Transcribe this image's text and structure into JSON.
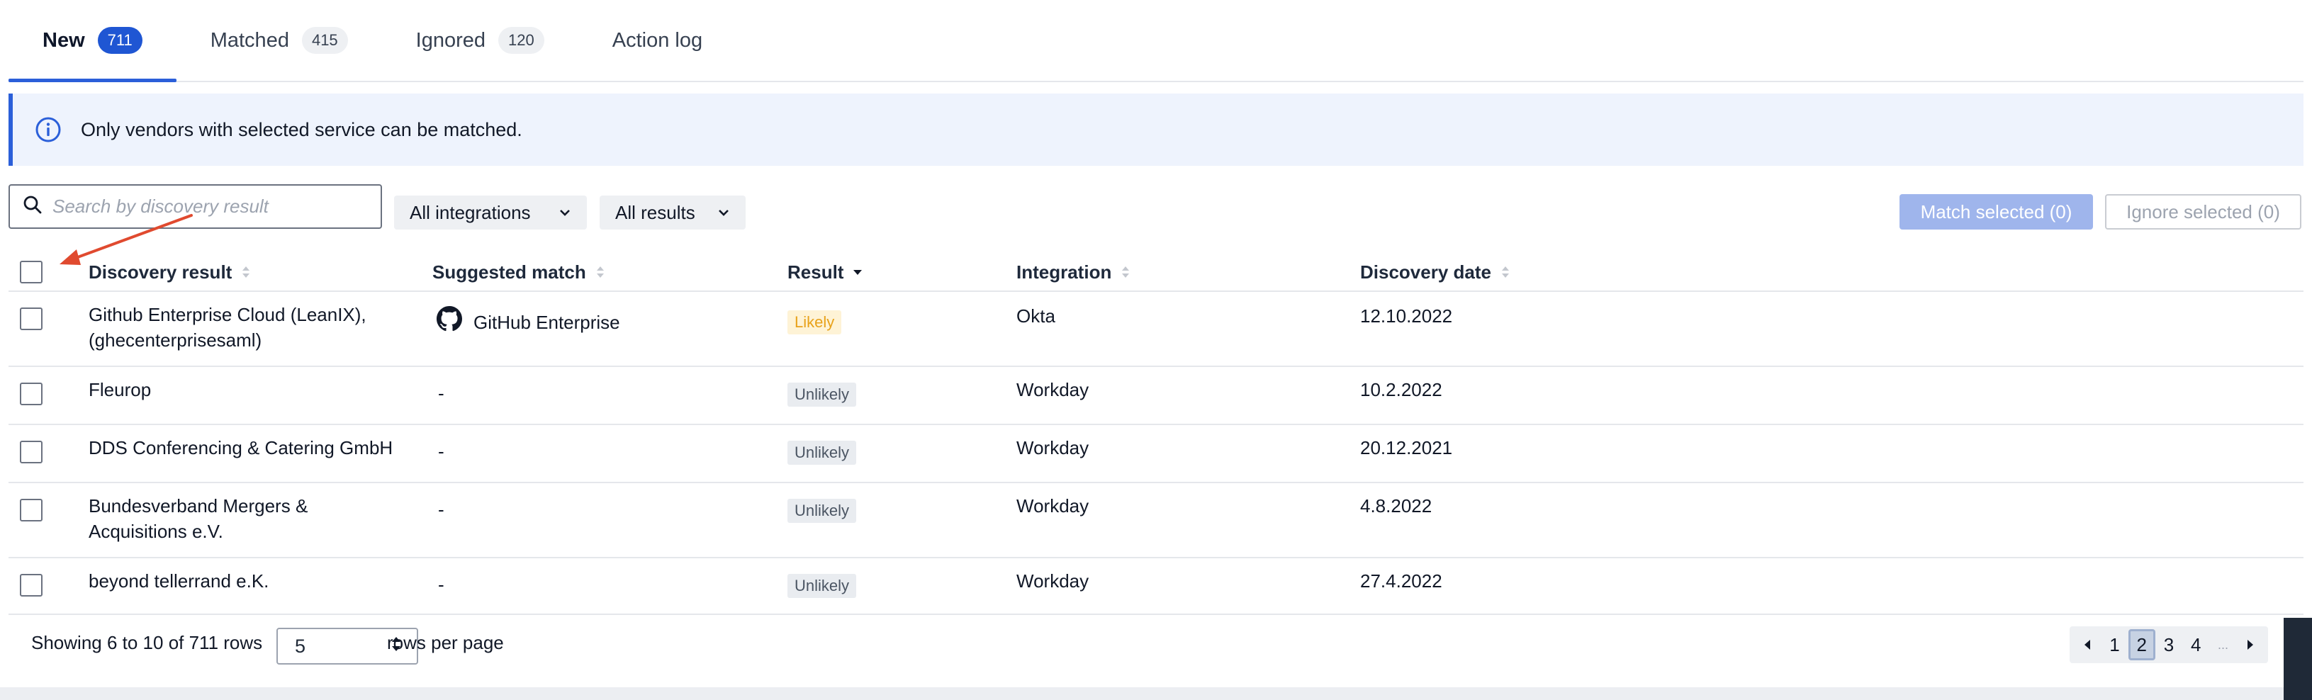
{
  "tabs": [
    {
      "label": "New",
      "count": "711",
      "active": true
    },
    {
      "label": "Matched",
      "count": "415",
      "active": false
    },
    {
      "label": "Ignored",
      "count": "120",
      "active": false
    },
    {
      "label": "Action log",
      "count": null,
      "active": false
    }
  ],
  "banner": {
    "icon": "info-icon",
    "text": "Only vendors with selected service can be matched."
  },
  "filters": {
    "search_placeholder": "Search by discovery result",
    "search_value": "",
    "integration_select": "All integrations",
    "results_select": "All results",
    "match_selected": "Match selected (0)",
    "ignore_selected": "Ignore selected (0)"
  },
  "table": {
    "columns": [
      {
        "label": "Discovery result",
        "sort": "none"
      },
      {
        "label": "Suggested match",
        "sort": "none"
      },
      {
        "label": "Result",
        "sort": "descending"
      },
      {
        "label": "Integration",
        "sort": "none"
      },
      {
        "label": "Discovery date",
        "sort": "none"
      }
    ],
    "rows": [
      {
        "discovery": [
          "Github Enterprise Cloud (LeanIX),",
          "(ghecenterprisesaml)"
        ],
        "match": "GitHub Enterprise",
        "match_icon": "github-icon",
        "result": "Likely",
        "integration": "Okta",
        "date": "12.10.2022"
      },
      {
        "discovery": [
          "Fleurop"
        ],
        "match": "-",
        "match_icon": null,
        "result": "Unlikely",
        "integration": "Workday",
        "date": "10.2.2022"
      },
      {
        "discovery": [
          "DDS Conferencing & Catering GmbH"
        ],
        "match": "-",
        "match_icon": null,
        "result": "Unlikely",
        "integration": "Workday",
        "date": "20.12.2021"
      },
      {
        "discovery": [
          "Bundesverband Mergers &",
          "Acquisitions e.V."
        ],
        "match": "-",
        "match_icon": null,
        "result": "Unlikely",
        "integration": "Workday",
        "date": "4.8.2022"
      },
      {
        "discovery": [
          "beyond tellerrand e.K."
        ],
        "match": "-",
        "match_icon": null,
        "result": "Unlikely",
        "integration": "Workday",
        "date": "27.4.2022"
      }
    ]
  },
  "footer": {
    "showing": "Showing 6 to 10 of 711 rows",
    "rows_per_page_value": "5",
    "rows_per_page_label": "rows per page",
    "pages": [
      "1",
      "2",
      "3",
      "4"
    ],
    "current_page": "2",
    "ellipsis": "..."
  },
  "colors": {
    "accent": "#1f56d3",
    "banner_bg": "#eef3fd",
    "likely_text": "#e8a21a",
    "arrow": "#e04a2f"
  }
}
